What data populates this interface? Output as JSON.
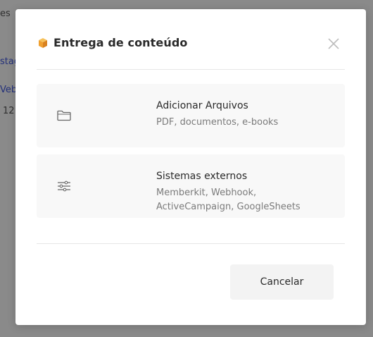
{
  "background": {
    "fragments": [
      "es",
      "stag",
      "Veb",
      "12"
    ]
  },
  "modal": {
    "title": "Entrega de conteúdo",
    "title_icon": "package-icon",
    "close_icon": "close-icon",
    "options": [
      {
        "icon": "folder-icon",
        "title": "Adicionar Arquivos",
        "description_lines": [
          "PDF, documentos, e-books"
        ]
      },
      {
        "icon": "sliders-icon",
        "title": "Sistemas externos",
        "description_lines": [
          "Memberkit, Webhook,",
          "ActiveCampaign, GoogleSheets"
        ]
      }
    ],
    "cancel_label": "Cancelar"
  },
  "colors": {
    "overlay": "#8a8a8a",
    "modal_bg": "#ffffff",
    "option_bg": "#f8f8f8",
    "accent_orange": "#f0a030",
    "link_blue": "#23307a"
  }
}
